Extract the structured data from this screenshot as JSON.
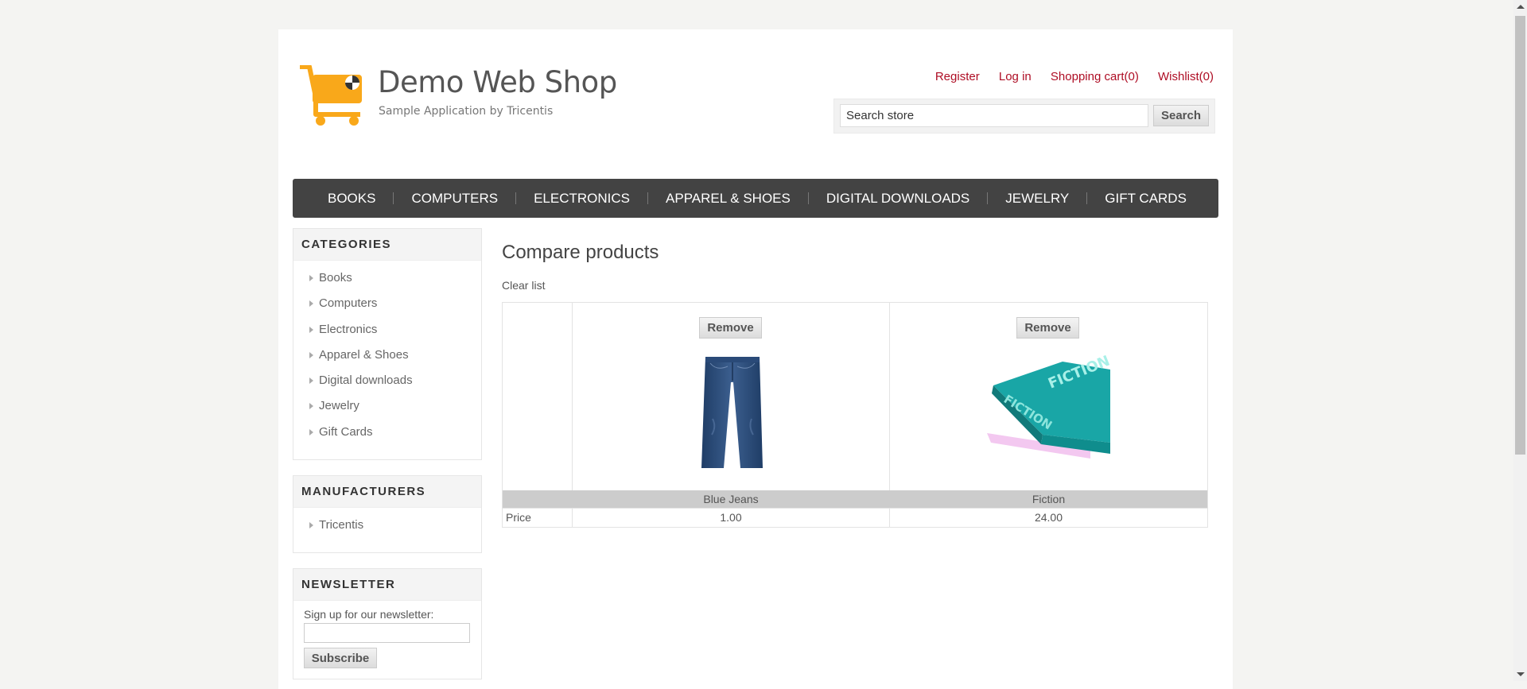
{
  "header": {
    "logo_title": "Demo Web Shop",
    "logo_subtitle": "Sample Application by Tricentis",
    "links": [
      "Register",
      "Log in",
      "Shopping cart(0)",
      "Wishlist(0)"
    ],
    "search_value": "Search store",
    "search_button": "Search"
  },
  "nav": [
    "BOOKS",
    "COMPUTERS",
    "ELECTRONICS",
    "APPAREL & SHOES",
    "DIGITAL DOWNLOADS",
    "JEWELRY",
    "GIFT CARDS"
  ],
  "sidebar": {
    "categories_title": "CATEGORIES",
    "categories": [
      "Books",
      "Computers",
      "Electronics",
      "Apparel & Shoes",
      "Digital downloads",
      "Jewelry",
      "Gift Cards"
    ],
    "manufacturers_title": "MANUFACTURERS",
    "manufacturers": [
      "Tricentis"
    ],
    "newsletter_title": "NEWSLETTER",
    "newsletter_label": "Sign up for our newsletter:",
    "subscribe_button": "Subscribe"
  },
  "main": {
    "title": "Compare products",
    "clear_list": "Clear list",
    "remove_label": "Remove",
    "price_label": "Price",
    "products": [
      {
        "name": "Blue Jeans",
        "price": "1.00",
        "image_icon": "blue-jeans-image"
      },
      {
        "name": "Fiction",
        "price": "24.00",
        "image_icon": "fiction-book-image",
        "image_text": "FICTION"
      }
    ]
  },
  "colors": {
    "link": "#ae0d24",
    "nav_bg": "#434343",
    "logo_orange": "#f9a81a",
    "book_teal": "#19a6a6"
  }
}
